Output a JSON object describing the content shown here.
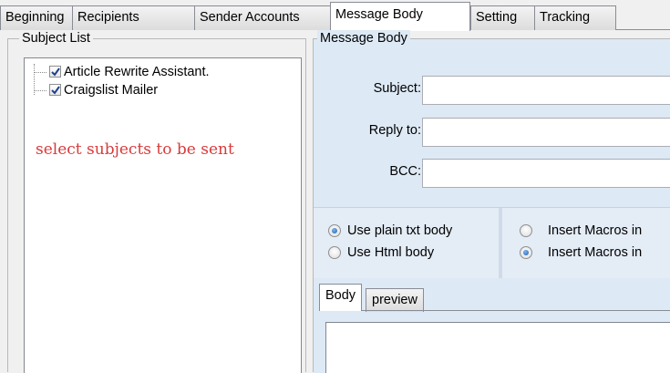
{
  "tabs": [
    {
      "label": "Beginning"
    },
    {
      "label": "Recipients"
    },
    {
      "label": "Sender Accounts"
    },
    {
      "label": "Message Body"
    },
    {
      "label": "Setting"
    },
    {
      "label": "Tracking"
    }
  ],
  "subject_list": {
    "title": "Subject List",
    "items": [
      {
        "label": "Article Rewrite Assistant.",
        "checked": true
      },
      {
        "label": "Craigslist Mailer",
        "checked": true
      }
    ],
    "hint": "select subjects to be sent"
  },
  "message_body": {
    "title": "Message Body",
    "fields": [
      {
        "label": "Subject:",
        "value": ""
      },
      {
        "label": "Reply to:",
        "value": ""
      },
      {
        "label": "BCC:",
        "value": ""
      }
    ],
    "body_options": [
      {
        "label": "Use plain txt body",
        "selected": true
      },
      {
        "label": "Use Html body",
        "selected": false
      }
    ],
    "macro_options": [
      {
        "label": "Insert Macros in",
        "selected": false
      },
      {
        "label": "Insert Macros in",
        "selected": true
      }
    ],
    "editor_tabs": [
      {
        "label": "Body"
      },
      {
        "label": "preview"
      }
    ],
    "body_text": ""
  },
  "colors": {
    "hint": "#d83b3b",
    "panel": "#dde9f5"
  }
}
